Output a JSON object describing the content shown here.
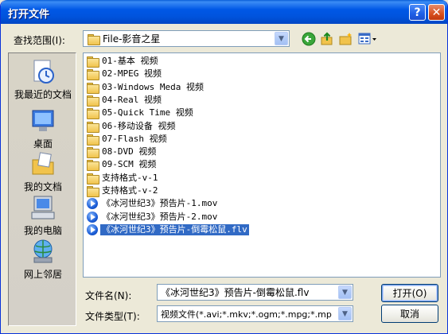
{
  "window": {
    "title": "打开文件",
    "help_label": "?",
    "close_label": "✕"
  },
  "lookin": {
    "label": "查找范围(I):",
    "value": "File-影音之星"
  },
  "toolbar": {
    "back_icon": "back-arrow-icon",
    "up_icon": "up-folder-icon",
    "newfolder_icon": "new-folder-icon",
    "views_icon": "views-menu-icon"
  },
  "places": [
    {
      "label": "我最近的文档",
      "icon": "recent-documents-icon"
    },
    {
      "label": "桌面",
      "icon": "desktop-icon"
    },
    {
      "label": "我的文档",
      "icon": "my-documents-icon"
    },
    {
      "label": "我的电脑",
      "icon": "my-computer-icon"
    },
    {
      "label": "网上邻居",
      "icon": "network-places-icon"
    }
  ],
  "files": [
    {
      "name": "01-基本 视频",
      "type": "folder"
    },
    {
      "name": "02-MPEG 视频",
      "type": "folder"
    },
    {
      "name": "03-Windows Meda 视频",
      "type": "folder"
    },
    {
      "name": "04-Real 视频",
      "type": "folder"
    },
    {
      "name": "05-Quick Time 视频",
      "type": "folder"
    },
    {
      "name": "06-移动设备 视频",
      "type": "folder"
    },
    {
      "name": "07-Flash 视频",
      "type": "folder"
    },
    {
      "name": "08-DVD 视频",
      "type": "folder"
    },
    {
      "name": "09-SCM 视频",
      "type": "folder"
    },
    {
      "name": "支持格式-v-1",
      "type": "folder"
    },
    {
      "name": "支持格式-v-2",
      "type": "folder"
    },
    {
      "name": "《冰河世纪3》预告片-1.mov",
      "type": "media"
    },
    {
      "name": "《冰河世纪3》预告片-2.mov",
      "type": "media"
    },
    {
      "name": "《冰河世纪3》预告片-倒霉松鼠.flv",
      "type": "media",
      "selected": true
    }
  ],
  "filename": {
    "label": "文件名(N):",
    "value": "《冰河世纪3》预告片-倒霉松鼠.flv"
  },
  "filetype": {
    "label": "文件类型(T):",
    "value": "视频文件(*.avi;*.mkv;*.ogm;*.mpg;*.mp"
  },
  "buttons": {
    "open": "打开(O)",
    "cancel": "取消"
  },
  "colors": {
    "titlebar": "#0058e6",
    "selection": "#316ac5",
    "dialog_bg": "#ece9d8"
  }
}
